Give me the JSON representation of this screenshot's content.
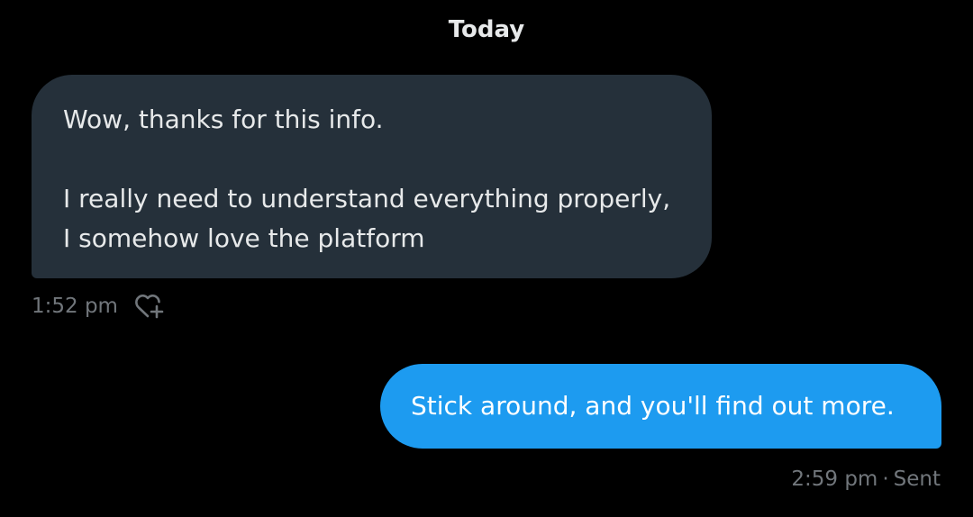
{
  "date_divider": "Today",
  "messages": [
    {
      "direction": "received",
      "lines": [
        "Wow, thanks for this info.",
        "I really need to understand everything properly,",
        "I somehow love the platform"
      ],
      "time": "1:52 pm",
      "react_icon": "heart-plus-icon"
    },
    {
      "direction": "sent",
      "text": "Stick around, and you'll find out more.",
      "time": "2:59 pm",
      "separator": "·",
      "status": "Sent"
    }
  ],
  "colors": {
    "background": "#000000",
    "received_bubble": "#25303A",
    "sent_bubble": "#1D9BF0",
    "primary_text": "#E7E9EA",
    "secondary_text": "#71767B"
  }
}
